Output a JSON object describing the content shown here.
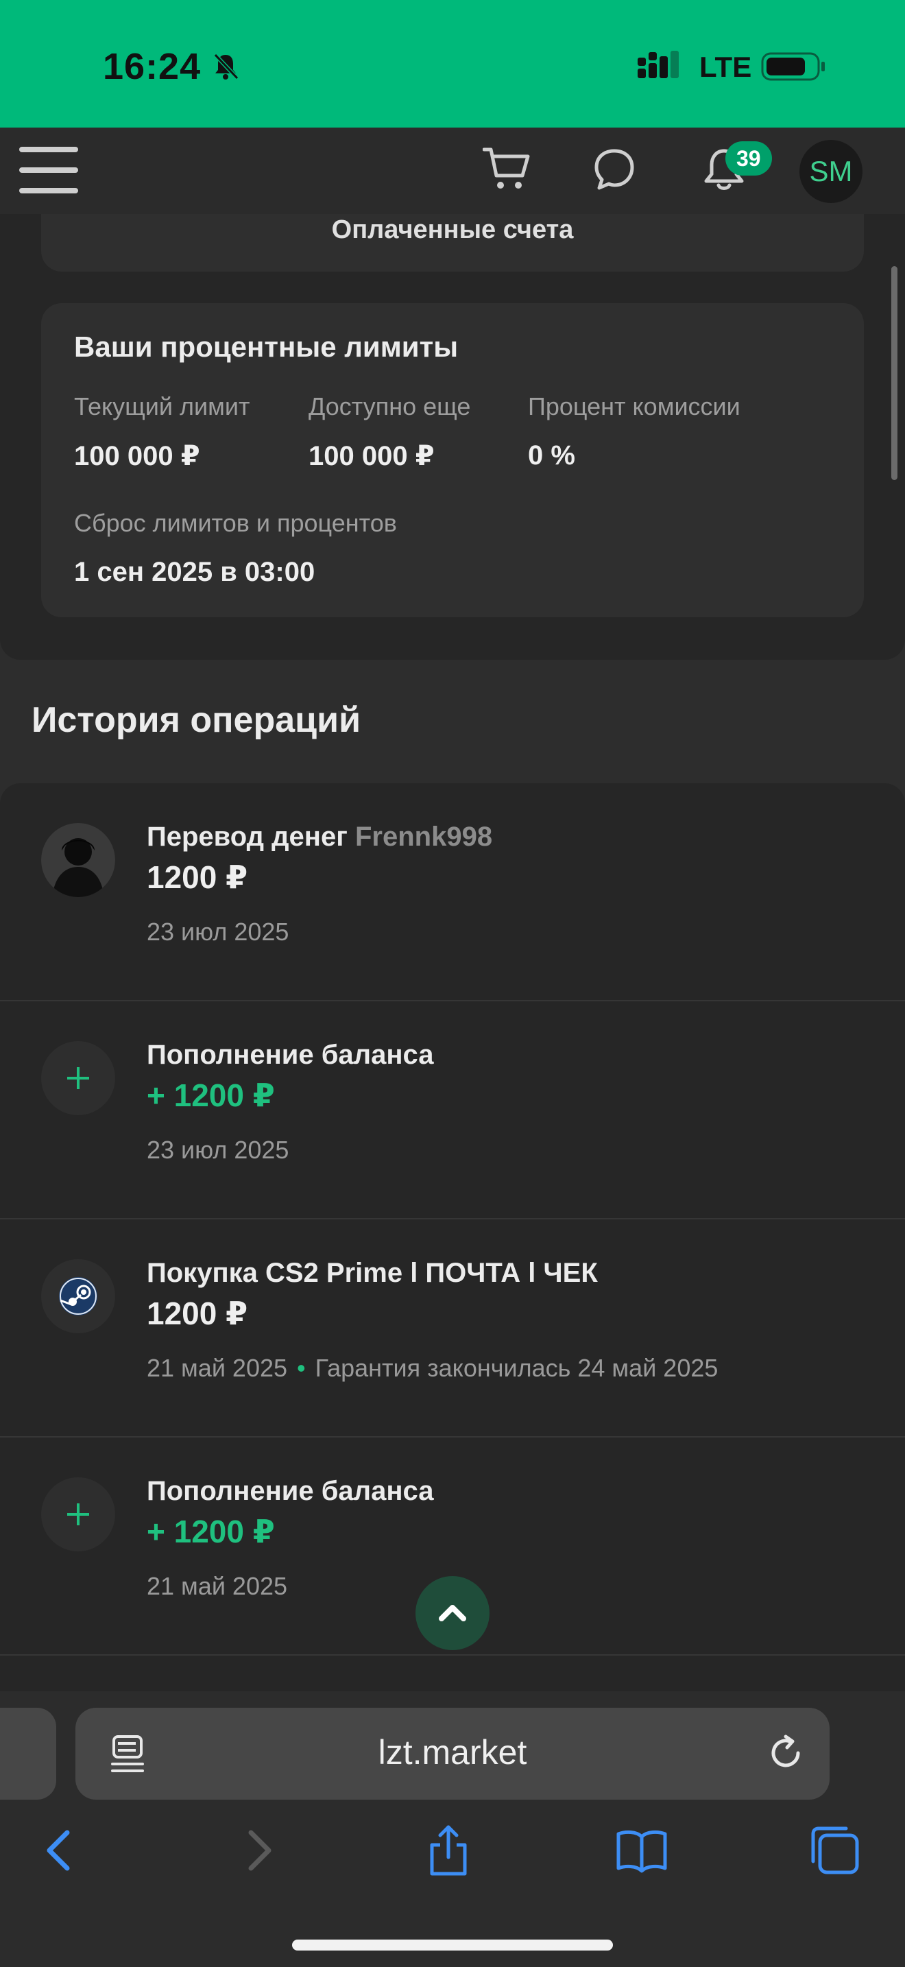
{
  "status_bar": {
    "time": "16:24",
    "network": "LTE"
  },
  "header": {
    "notifications_count": "39",
    "avatar_initials": "SM"
  },
  "paid_card": {
    "label": "Оплаченные счета"
  },
  "limits": {
    "title": "Ваши процентные лимиты",
    "current_limit_label": "Текущий лимит",
    "current_limit_value": "100 000 ₽",
    "available_label": "Доступно еще",
    "available_value": "100 000 ₽",
    "commission_label": "Процент комиссии",
    "commission_value": "0 %",
    "reset_label": "Сброс лимитов и процентов",
    "reset_value": "1 сен 2025 в 03:00"
  },
  "history": {
    "title": "История операций",
    "items": [
      {
        "title": "Перевод денег",
        "user": "Frennk998",
        "amount": "1200 ₽",
        "date": "23 июл 2025",
        "icon": "user-avatar"
      },
      {
        "title": "Пополнение баланса",
        "amount": "+ 1200 ₽",
        "date": "23 июл 2025",
        "icon": "plus-icon"
      },
      {
        "title": "Покупка CS2 Prime l ПОЧТА l ЧЕК",
        "amount": "1200 ₽",
        "date": "21 май 2025",
        "note": "Гарантия закончилась 24 май 2025",
        "icon": "steam-icon"
      },
      {
        "title": "Пополнение баланса",
        "amount": "+ 1200 ₽",
        "date": "21 май 2025",
        "icon": "plus-icon"
      }
    ]
  },
  "browser": {
    "url": "lzt.market"
  },
  "colors": {
    "accent": "#00b97a",
    "positive": "#1fc07f",
    "background": "#2d2d2d",
    "card": "#2f2f2f",
    "ios_blue": "#3d8ef5"
  }
}
